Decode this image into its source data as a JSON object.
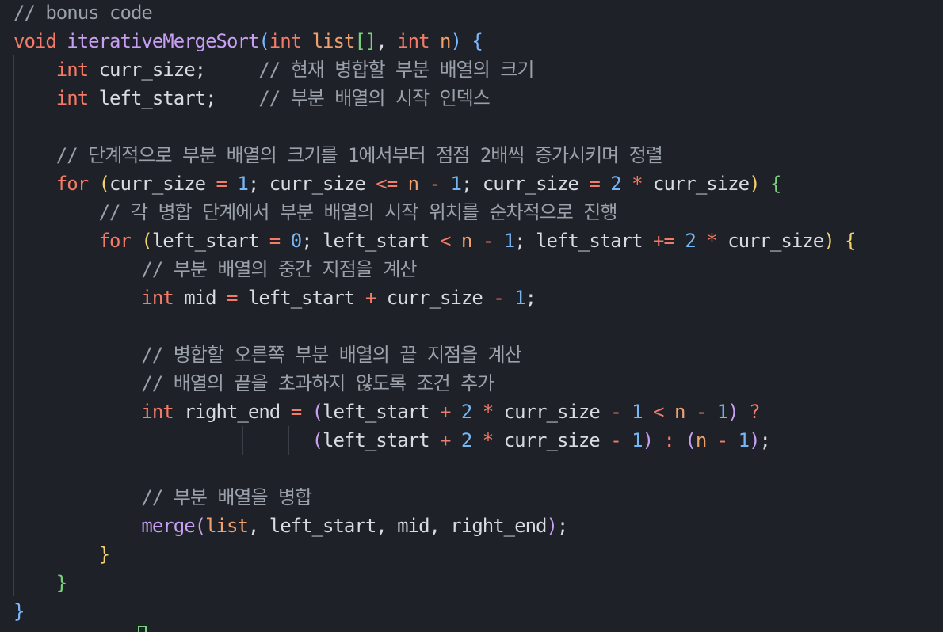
{
  "editor": {
    "language": "c",
    "theme": "dark",
    "lines": [
      [
        {
          "t": "// bonus code",
          "c": "cm"
        }
      ],
      [
        {
          "t": "void ",
          "c": "kw"
        },
        {
          "t": "iterativeMergeSort",
          "c": "fn"
        },
        {
          "t": "(",
          "c": "p1"
        },
        {
          "t": "int ",
          "c": "kw"
        },
        {
          "t": "list",
          "c": "id"
        },
        {
          "t": "[]",
          "c": "p4"
        },
        {
          "t": ", ",
          "c": "txt"
        },
        {
          "t": "int ",
          "c": "kw"
        },
        {
          "t": "n",
          "c": "id"
        },
        {
          "t": ")",
          "c": "p1"
        },
        {
          "t": " ",
          "c": "txt"
        },
        {
          "t": "{",
          "c": "p1"
        }
      ],
      [
        {
          "t": "    ",
          "c": "txt"
        },
        {
          "t": "int ",
          "c": "kw"
        },
        {
          "t": "curr_size;     ",
          "c": "txt"
        },
        {
          "t": "// 현재 병합할 부분 배열의 크기",
          "c": "cm"
        }
      ],
      [
        {
          "t": "    ",
          "c": "txt"
        },
        {
          "t": "int ",
          "c": "kw"
        },
        {
          "t": "left_start;    ",
          "c": "txt"
        },
        {
          "t": "// 부분 배열의 시작 인덱스",
          "c": "cm"
        }
      ],
      [],
      [
        {
          "t": "    ",
          "c": "txt"
        },
        {
          "t": "// 단계적으로 부분 배열의 크기를 1에서부터 점점 2배씩 증가시키며 정렬",
          "c": "cm"
        }
      ],
      [
        {
          "t": "    ",
          "c": "txt"
        },
        {
          "t": "for ",
          "c": "kw"
        },
        {
          "t": "(",
          "c": "p2"
        },
        {
          "t": "curr_size ",
          "c": "txt"
        },
        {
          "t": "= ",
          "c": "op"
        },
        {
          "t": "1",
          "c": "num"
        },
        {
          "t": "; curr_size ",
          "c": "txt"
        },
        {
          "t": "<= ",
          "c": "op"
        },
        {
          "t": "n ",
          "c": "id"
        },
        {
          "t": "- ",
          "c": "op"
        },
        {
          "t": "1",
          "c": "num"
        },
        {
          "t": "; curr_size ",
          "c": "txt"
        },
        {
          "t": "= ",
          "c": "op"
        },
        {
          "t": "2 ",
          "c": "num"
        },
        {
          "t": "* ",
          "c": "op"
        },
        {
          "t": "curr_size",
          "c": "txt"
        },
        {
          "t": ")",
          "c": "p2"
        },
        {
          "t": " ",
          "c": "txt"
        },
        {
          "t": "{",
          "c": "p4"
        }
      ],
      [
        {
          "t": "        ",
          "c": "txt"
        },
        {
          "t": "// 각 병합 단계에서 부분 배열의 시작 위치를 순차적으로 진행",
          "c": "cm"
        }
      ],
      [
        {
          "t": "        ",
          "c": "txt"
        },
        {
          "t": "for ",
          "c": "kw"
        },
        {
          "t": "(",
          "c": "p2"
        },
        {
          "t": "left_start ",
          "c": "txt"
        },
        {
          "t": "= ",
          "c": "op"
        },
        {
          "t": "0",
          "c": "num"
        },
        {
          "t": "; left_start ",
          "c": "txt"
        },
        {
          "t": "< ",
          "c": "op"
        },
        {
          "t": "n ",
          "c": "id"
        },
        {
          "t": "- ",
          "c": "op"
        },
        {
          "t": "1",
          "c": "num"
        },
        {
          "t": "; left_start ",
          "c": "txt"
        },
        {
          "t": "+= ",
          "c": "op"
        },
        {
          "t": "2 ",
          "c": "num"
        },
        {
          "t": "* ",
          "c": "op"
        },
        {
          "t": "curr_size",
          "c": "txt"
        },
        {
          "t": ")",
          "c": "p2"
        },
        {
          "t": " ",
          "c": "txt"
        },
        {
          "t": "{",
          "c": "p2"
        }
      ],
      [
        {
          "t": "            ",
          "c": "txt"
        },
        {
          "t": "// 부분 배열의 중간 지점을 계산",
          "c": "cm"
        }
      ],
      [
        {
          "t": "            ",
          "c": "txt"
        },
        {
          "t": "int ",
          "c": "kw"
        },
        {
          "t": "mid ",
          "c": "txt"
        },
        {
          "t": "= ",
          "c": "op"
        },
        {
          "t": "left_start ",
          "c": "txt"
        },
        {
          "t": "+ ",
          "c": "op"
        },
        {
          "t": "curr_size ",
          "c": "txt"
        },
        {
          "t": "- ",
          "c": "op"
        },
        {
          "t": "1",
          "c": "num"
        },
        {
          "t": ";",
          "c": "txt"
        }
      ],
      [],
      [
        {
          "t": "            ",
          "c": "txt"
        },
        {
          "t": "// 병합할 오른쪽 부분 배열의 끝 지점을 계산",
          "c": "cm"
        }
      ],
      [
        {
          "t": "            ",
          "c": "txt"
        },
        {
          "t": "// 배열의 끝을 초과하지 않도록 조건 추가",
          "c": "cm"
        }
      ],
      [
        {
          "t": "            ",
          "c": "txt"
        },
        {
          "t": "int ",
          "c": "kw"
        },
        {
          "t": "right_end ",
          "c": "txt"
        },
        {
          "t": "= ",
          "c": "op"
        },
        {
          "t": "(",
          "c": "p3"
        },
        {
          "t": "left_start ",
          "c": "txt"
        },
        {
          "t": "+ ",
          "c": "op"
        },
        {
          "t": "2 ",
          "c": "num"
        },
        {
          "t": "* ",
          "c": "op"
        },
        {
          "t": "curr_size ",
          "c": "txt"
        },
        {
          "t": "- ",
          "c": "op"
        },
        {
          "t": "1 ",
          "c": "num"
        },
        {
          "t": "< ",
          "c": "op"
        },
        {
          "t": "n ",
          "c": "id"
        },
        {
          "t": "- ",
          "c": "op"
        },
        {
          "t": "1",
          "c": "num"
        },
        {
          "t": ")",
          "c": "p3"
        },
        {
          "t": " ",
          "c": "txt"
        },
        {
          "t": "?",
          "c": "op"
        }
      ],
      [
        {
          "t": "                            ",
          "c": "txt"
        },
        {
          "t": "(",
          "c": "p3"
        },
        {
          "t": "left_start ",
          "c": "txt"
        },
        {
          "t": "+ ",
          "c": "op"
        },
        {
          "t": "2 ",
          "c": "num"
        },
        {
          "t": "* ",
          "c": "op"
        },
        {
          "t": "curr_size ",
          "c": "txt"
        },
        {
          "t": "- ",
          "c": "op"
        },
        {
          "t": "1",
          "c": "num"
        },
        {
          "t": ")",
          "c": "p3"
        },
        {
          "t": " ",
          "c": "txt"
        },
        {
          "t": ": ",
          "c": "op"
        },
        {
          "t": "(",
          "c": "p3"
        },
        {
          "t": "n ",
          "c": "id"
        },
        {
          "t": "- ",
          "c": "op"
        },
        {
          "t": "1",
          "c": "num"
        },
        {
          "t": ")",
          "c": "p3"
        },
        {
          "t": ";",
          "c": "txt"
        }
      ],
      [],
      [
        {
          "t": "            ",
          "c": "txt"
        },
        {
          "t": "// 부분 배열을 병합",
          "c": "cm"
        }
      ],
      [
        {
          "t": "            ",
          "c": "txt"
        },
        {
          "t": "merge",
          "c": "fn"
        },
        {
          "t": "(",
          "c": "p3"
        },
        {
          "t": "list",
          "c": "id"
        },
        {
          "t": ", left_start, mid, right_end",
          "c": "txt"
        },
        {
          "t": ")",
          "c": "p3"
        },
        {
          "t": ";",
          "c": "txt"
        }
      ],
      [
        {
          "t": "        ",
          "c": "txt"
        },
        {
          "t": "}",
          "c": "p2"
        }
      ],
      [
        {
          "t": "    ",
          "c": "txt"
        },
        {
          "t": "}",
          "c": "p4"
        }
      ],
      [
        {
          "t": "}",
          "c": "p1"
        }
      ]
    ]
  }
}
